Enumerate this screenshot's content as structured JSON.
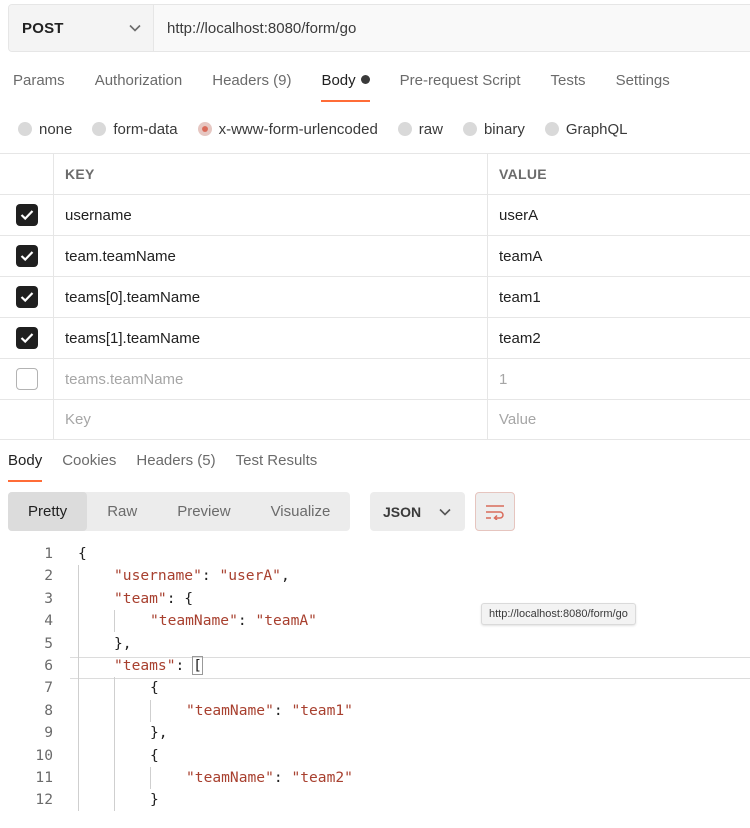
{
  "request": {
    "method": "POST",
    "url": "http://localhost:8080/form/go"
  },
  "request_tabs": [
    {
      "label": "Params"
    },
    {
      "label": "Authorization"
    },
    {
      "label": "Headers (9)"
    },
    {
      "label": "Body"
    },
    {
      "label": "Pre-request Script"
    },
    {
      "label": "Tests"
    },
    {
      "label": "Settings"
    }
  ],
  "body_types": [
    {
      "label": "none"
    },
    {
      "label": "form-data"
    },
    {
      "label": "x-www-form-urlencoded"
    },
    {
      "label": "raw"
    },
    {
      "label": "binary"
    },
    {
      "label": "GraphQL"
    }
  ],
  "params_table": {
    "headers": {
      "key": "KEY",
      "value": "VALUE"
    },
    "rows": [
      {
        "key": "username",
        "value": "userA",
        "checked": true
      },
      {
        "key": "team.teamName",
        "value": "teamA",
        "checked": true
      },
      {
        "key": "teams[0].teamName",
        "value": "team1",
        "checked": true
      },
      {
        "key": "teams[1].teamName",
        "value": "team2",
        "checked": true
      },
      {
        "key": "teams.teamName",
        "value": "1",
        "checked": false
      }
    ],
    "placeholder": {
      "key": "Key",
      "value": "Value"
    }
  },
  "response_tabs": [
    {
      "label": "Body"
    },
    {
      "label": "Cookies"
    },
    {
      "label": "Headers (5)"
    },
    {
      "label": "Test Results"
    }
  ],
  "view_modes": [
    {
      "label": "Pretty"
    },
    {
      "label": "Raw"
    },
    {
      "label": "Preview"
    },
    {
      "label": "Visualize"
    }
  ],
  "format": "JSON",
  "tooltip": "http://localhost:8080/form/go",
  "code": {
    "line_numbers": [
      "1",
      "2",
      "3",
      "4",
      "5",
      "6",
      "7",
      "8",
      "9",
      "10",
      "11",
      "12"
    ],
    "lines": [
      {
        "open": "{"
      },
      {
        "key": "\"username\"",
        "sep": ": ",
        "val": "\"userA\"",
        "end": ","
      },
      {
        "key": "\"team\"",
        "sep": ": ",
        "end": "{"
      },
      {
        "key": "\"teamName\"",
        "sep": ": ",
        "val": "\"teamA\""
      },
      {
        "end": "},"
      },
      {
        "key": "\"teams\"",
        "sep": ": ",
        "end": "["
      },
      {
        "end": "{"
      },
      {
        "key": "\"teamName\"",
        "sep": ": ",
        "val": "\"team1\""
      },
      {
        "end": "},"
      },
      {
        "end": "{"
      },
      {
        "key": "\"teamName\"",
        "sep": ": ",
        "val": "\"team2\""
      },
      {
        "end": "}"
      }
    ]
  },
  "colors": {
    "accent": "#ff6c37",
    "json_string": "#a8402f"
  }
}
